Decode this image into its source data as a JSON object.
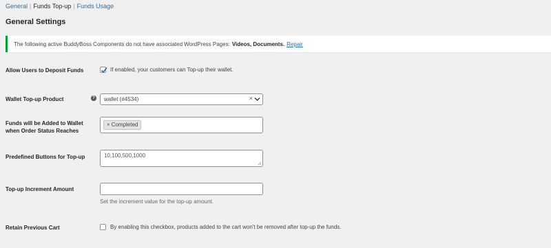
{
  "subnav": {
    "general": "General",
    "funds_topup": "Funds Top-up",
    "funds_usage": "Funds Usage",
    "separator": "|"
  },
  "section_title": "General Settings",
  "notice": {
    "text": "The following active BuddyBoss Components do not have associated WordPress Pages:",
    "components": "Videos, Documents.",
    "repair_link": "Repair",
    "border_color": "#00a32a"
  },
  "fields": {
    "allow_deposit": {
      "label": "Allow Users to Deposit Funds",
      "checked": true,
      "description": "If enabled, your customers can Top-up their wallet."
    },
    "topup_product": {
      "label": "Wallet Top-up Product",
      "help_icon": "question-circle-icon",
      "help_glyph": "?",
      "value": "wallet (#4534)",
      "clear_glyph": "×"
    },
    "order_status": {
      "label_line1": "Funds will be Added to Wallet",
      "label_line2": "when Order Status Reaches",
      "tags": [
        "Completed"
      ],
      "tag_remove_glyph": "×"
    },
    "predefined_buttons": {
      "label": "Predefined Buttons for Top-up",
      "value": "10,100,500,1000"
    },
    "increment_amount": {
      "label": "Top-up Increment Amount",
      "value": "",
      "description": "Set the increment value for the top-up amount."
    },
    "retain_cart": {
      "label": "Retain Previous Cart",
      "checked": false,
      "description": "By enabling this checkbox, products added to the cart won't be removed after top-up the funds."
    }
  },
  "colors": {
    "background": "#f0f0f1",
    "link": "#2271b1",
    "checkbox_accent": "#2271b1"
  }
}
